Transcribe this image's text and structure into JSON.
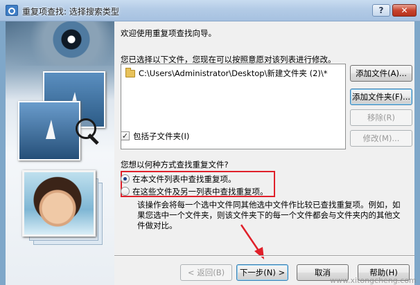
{
  "window": {
    "title": "重复项查找: 选择搜索类型",
    "help_label": "?",
    "close_label": "✕"
  },
  "wizard": {
    "welcome": "欢迎使用重复项查找向导。",
    "files_prompt": "您已选择以下文件，您现在可以按照意愿对该列表进行修改。",
    "file_list": [
      "C:\\Users\\Administrator\\Desktop\\新建文件夹 (2)\\*"
    ],
    "buttons": {
      "add_file": "添加文件(A)...",
      "add_folder": "添加文件夹(F)...",
      "remove": "移除(R)",
      "edit": "修改(M)..."
    },
    "include_subfolders": {
      "label": "包括子文件夹(I)",
      "checked": true
    },
    "search_question": "您想以何种方式查找重复文件?",
    "options": [
      {
        "label": "在本文件列表中查找重复项。",
        "selected": true
      },
      {
        "label": "在这些文件及另一列表中查找重复项。",
        "selected": false
      }
    ],
    "description": "该操作会将每一个选中文件同其他选中文件作比较已查找重复项。例如，如果您选中一个文件夹，则该文件夹下的每一个文件都会与文件夹内的其他文件做对比。"
  },
  "footer": {
    "back": "< 返回(B)",
    "next": "下一步(N) >",
    "cancel": "取消",
    "help": "帮助(H)"
  },
  "annotation_color": "#e0202a",
  "watermark": "www.xitongcheng.com"
}
